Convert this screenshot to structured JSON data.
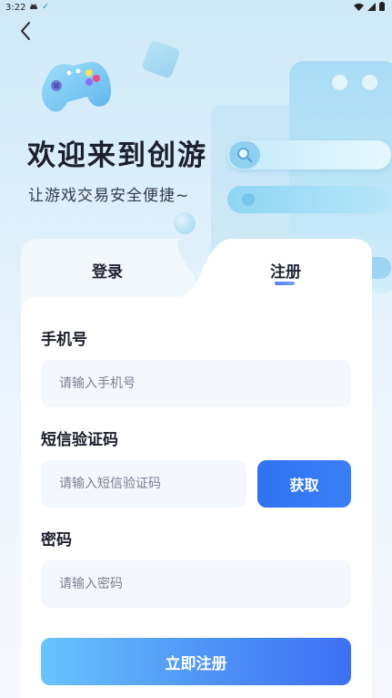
{
  "status_bar": {
    "time": "3:22",
    "icons": [
      "android-icon",
      "check-icon",
      "wifi-icon",
      "signal-icon",
      "battery-icon"
    ]
  },
  "header": {
    "title": "欢迎来到创游",
    "subtitle": "让游戏交易安全便捷~"
  },
  "tabs": [
    {
      "label": "登录",
      "active": false
    },
    {
      "label": "注册",
      "active": true
    }
  ],
  "form": {
    "phone": {
      "label": "手机号",
      "placeholder": "请输入手机号",
      "value": ""
    },
    "sms_code": {
      "label": "短信验证码",
      "placeholder": "请输入短信验证码",
      "value": "",
      "button_label": "获取"
    },
    "password": {
      "label": "密码",
      "placeholder": "请输入密码",
      "value": ""
    },
    "submit_label": "立即注册"
  },
  "colors": {
    "primary": "#2f73f2",
    "gradient_start": "#68c4fb",
    "gradient_end": "#3d6ff3",
    "title_text": "#1b1f2e",
    "input_bg": "#f4f7fe"
  }
}
